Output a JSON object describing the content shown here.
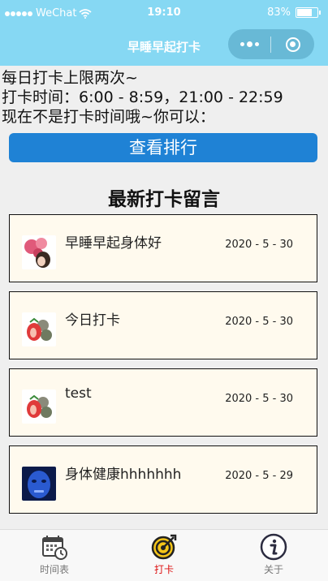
{
  "status_bar": {
    "carrier": "WeChat",
    "time": "19:10",
    "battery": "83%",
    "battery_level": 0.83
  },
  "nav": {
    "title": "早睡早起打卡"
  },
  "info": {
    "line1": "每日打卡上限两次~",
    "line2": "打卡时间：6:00 - 8:59，21:00 - 22:59",
    "line3": "现在不是打卡时间哦~你可以："
  },
  "rank_button": "查看排行",
  "section_title": "最新打卡留言",
  "posts": [
    {
      "message": "早睡早起身体好",
      "date": "2020 - 5 - 30",
      "avatar": "flowers-avatar"
    },
    {
      "message": "今日打卡",
      "date": "2020 - 5 - 30",
      "avatar": "strawberry-avatar"
    },
    {
      "message": "test",
      "date": "2020 - 5 - 30",
      "avatar": "strawberry-avatar"
    },
    {
      "message": "身体健康hhhhhhh",
      "date": "2020 - 5 - 29",
      "avatar": "blue-face-avatar"
    }
  ],
  "tabs": [
    {
      "label": "时间表",
      "icon": "calendar-clock-icon",
      "active": false
    },
    {
      "label": "打卡",
      "icon": "target-icon",
      "active": true
    },
    {
      "label": "关于",
      "icon": "info-icon",
      "active": false
    }
  ],
  "colors": {
    "nav_bg": "#86d8f3",
    "button_bg": "#1f82d5",
    "card_bg": "#fffaee",
    "active_tab": "#dd1111"
  }
}
